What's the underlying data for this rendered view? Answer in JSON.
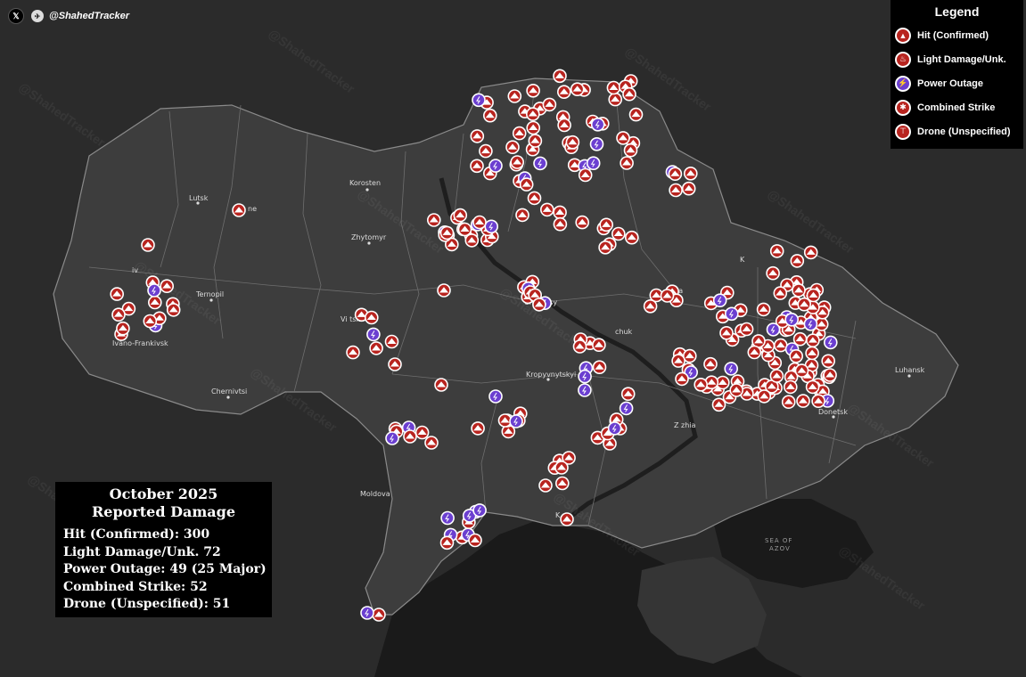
{
  "brand": {
    "x_icon": "x-logo-icon",
    "bird_icon": "shahed-bird-icon",
    "handle": "@ShahedTracker"
  },
  "watermark": "@ShahedTracker",
  "colors": {
    "hit": "#b8241f",
    "light": "#b8241f",
    "power": "#6b3fd0",
    "combined": "#b8241f",
    "drone": "#b8241f",
    "marker_border": "#ffffff",
    "land_ukraine": "#3d3d3d",
    "land_other": "#2b2b2b",
    "sea": "#1a1a1a",
    "borders": "#7c7c7c"
  },
  "cities": {
    "lutsk": "Lutsk",
    "korosten": "Korosten",
    "zhytomyr": "Zhytomyr",
    "ternopil": "Ternopil",
    "ivano": "Ivano-Frankivsk",
    "chernivtsi": "Chernivtsi",
    "cherkasy": "Cherkasy",
    "kropyvnytskyi": "Kropyvnytskyi",
    "luhansk": "Luhansk",
    "donetsk": "Donetsk",
    "moldova": "Moldova",
    "sea_of_azov_1": "SEA OF",
    "sea_of_azov_2": "AZOV",
    "lviv_frag": "iv",
    "rivne_frag": "ne",
    "vinnytsia_frag": "Vi       tsia",
    "kremenchuk_frag": "chuk",
    "zaporizhzhia_frag": "Z      zhia",
    "kherson_frag": "K       on",
    "poltava_frag": "ra",
    "kharkiv_frag": "K"
  },
  "legend": {
    "title": "Legend",
    "items": [
      {
        "key": "hit",
        "label": "Hit (Confirmed)",
        "icon": "explosion-icon"
      },
      {
        "key": "light",
        "label": "Light Damage/Unk.",
        "icon": "flame-icon"
      },
      {
        "key": "power",
        "label": "Power Outage",
        "icon": "lightning-icon"
      },
      {
        "key": "combined",
        "label": "Combined Strike",
        "icon": "starburst-icon"
      },
      {
        "key": "drone",
        "label": "Drone (Unspecified)",
        "icon": "drone-icon"
      }
    ]
  },
  "summary": {
    "title_line1": "October 2025",
    "title_line2": "Reported Damage",
    "stats": [
      {
        "label": "Hit (Confirmed):",
        "value": "300"
      },
      {
        "label": "Light Damage/Unk.",
        "value": "72"
      },
      {
        "label": "Power Outage:",
        "value": "49 (25 Major)"
      },
      {
        "label": "Combined Strike:",
        "value": "52"
      },
      {
        "label": "Drone (Unspecified):",
        "value": "51"
      }
    ]
  }
}
